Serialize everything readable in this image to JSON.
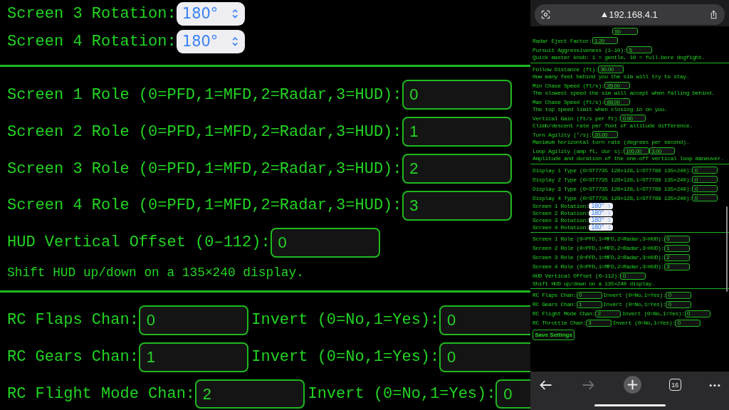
{
  "zoomed_view": {
    "rows": [
      {
        "kind": "select",
        "label": "Screen 3 Rotation:",
        "value": "180°"
      },
      {
        "kind": "select",
        "label": "Screen 4 Rotation:",
        "value": "180°"
      },
      {
        "kind": "rule"
      },
      {
        "kind": "field",
        "parts": [
          {
            "label": "Screen 1 Role (0=PFD,1=MFD,2=Radar,3=HUD):",
            "value": "0"
          }
        ]
      },
      {
        "kind": "field",
        "parts": [
          {
            "label": "Screen 2 Role (0=PFD,1=MFD,2=Radar,3=HUD):",
            "value": "1"
          }
        ]
      },
      {
        "kind": "field",
        "parts": [
          {
            "label": "Screen 3 Role (0=PFD,1=MFD,2=Radar,3=HUD):",
            "value": "2"
          }
        ]
      },
      {
        "kind": "field",
        "parts": [
          {
            "label": "Screen 4 Role (0=PFD,1=MFD,2=Radar,3=HUD):",
            "value": "3"
          }
        ]
      },
      {
        "kind": "field",
        "parts": [
          {
            "label": "HUD Vertical Offset (0–112):",
            "value": "0"
          }
        ]
      },
      {
        "kind": "note",
        "text": "Shift HUD up/down on a 135×240 display."
      },
      {
        "kind": "rule"
      },
      {
        "kind": "field",
        "parts": [
          {
            "label": "RC Flaps Chan:",
            "value": "0"
          },
          {
            "label": "Invert (0=No,1=Yes):",
            "value": "0"
          }
        ]
      },
      {
        "kind": "field",
        "parts": [
          {
            "label": "RC Gears Chan:",
            "value": "1"
          },
          {
            "label": "Invert (0=No,1=Yes):",
            "value": "0"
          }
        ]
      },
      {
        "kind": "field",
        "parts": [
          {
            "label": "RC Flight Mode Chan:",
            "value": "2"
          },
          {
            "label": "Invert (0=No,1=Yes):",
            "value": "0"
          }
        ]
      }
    ]
  },
  "browser": {
    "address": "192.168.4.1",
    "rows": [
      {
        "kind": "field",
        "parts": [
          {
            "value": "50"
          }
        ]
      },
      {
        "kind": "field",
        "parts": [
          {
            "label": "Radar Eject Factor:",
            "value": "1.20"
          }
        ]
      },
      {
        "kind": "field",
        "parts": [
          {
            "label": "Pursuit Aggressiveness (1–10):",
            "value": "5"
          }
        ]
      },
      {
        "kind": "note",
        "text": "Quick master knob: 1 = gentle, 10 = full-bore dogfight."
      },
      {
        "kind": "rule"
      },
      {
        "kind": "field",
        "parts": [
          {
            "label": "Follow Distance (ft):",
            "value": "30.00"
          }
        ]
      },
      {
        "kind": "note",
        "text": "How many feet behind you the sim will try to stay."
      },
      {
        "kind": "field",
        "parts": [
          {
            "label": "Min Chase Speed (ft/s):",
            "value": "35.00"
          }
        ]
      },
      {
        "kind": "note",
        "text": "The slowest speed the sim will accept when falling behind."
      },
      {
        "kind": "field",
        "parts": [
          {
            "label": "Max Chase Speed (ft/s):",
            "value": "88.00"
          }
        ]
      },
      {
        "kind": "note",
        "text": "The top speed limit when closing in on you."
      },
      {
        "kind": "field",
        "parts": [
          {
            "label": "Vertical Gain (ft/s per ft):",
            "value": "0.90"
          }
        ]
      },
      {
        "kind": "note",
        "text": "Climb/descent rate per foot of altitude difference."
      },
      {
        "kind": "field",
        "parts": [
          {
            "label": "Turn Agility (°/s):",
            "value": "20.00"
          }
        ]
      },
      {
        "kind": "note",
        "text": "Maximum horizontal turn rate (degrees per second)."
      },
      {
        "kind": "field",
        "parts": [
          {
            "label": "Loop Agility (amp ft, dur s):",
            "value": "100.00"
          },
          {
            "value": "3.00"
          }
        ]
      },
      {
        "kind": "note",
        "text": "Amplitude and duration of the one-off vertical loop maneuver."
      },
      {
        "kind": "rule"
      },
      {
        "kind": "field",
        "parts": [
          {
            "label": "Display 1 Type (0=ST7735 128×128,1=ST7789 135×240):",
            "value": "0"
          }
        ]
      },
      {
        "kind": "field",
        "parts": [
          {
            "label": "Display 2 Type (0=ST7735 128×128,1=ST7789 135×240):",
            "value": "0"
          }
        ]
      },
      {
        "kind": "field",
        "parts": [
          {
            "label": "Display 3 Type (0=ST7735 128×128,1=ST7789 135×240):",
            "value": "0"
          }
        ]
      },
      {
        "kind": "field",
        "parts": [
          {
            "label": "Display 4 Type (0=ST7735 128×128,1=ST7789 135×240):",
            "value": "0"
          }
        ]
      },
      {
        "kind": "select",
        "label": "Screen 1 Rotation:",
        "value": "180°"
      },
      {
        "kind": "select",
        "label": "Screen 2 Rotation:",
        "value": "180°"
      },
      {
        "kind": "select",
        "label": "Screen 3 Rotation:",
        "value": "180°"
      },
      {
        "kind": "select",
        "label": "Screen 4 Rotation:",
        "value": "180°"
      },
      {
        "kind": "rule"
      },
      {
        "kind": "field",
        "parts": [
          {
            "label": "Screen 1 Role (0=PFD,1=MFD,2=Radar,3=HUD):",
            "value": "0"
          }
        ]
      },
      {
        "kind": "field",
        "parts": [
          {
            "label": "Screen 2 Role (0=PFD,1=MFD,2=Radar,3=HUD):",
            "value": "1"
          }
        ]
      },
      {
        "kind": "field",
        "parts": [
          {
            "label": "Screen 3 Role (0=PFD,1=MFD,2=Radar,3=HUD):",
            "value": "2"
          }
        ]
      },
      {
        "kind": "field",
        "parts": [
          {
            "label": "Screen 4 Role (0=PFD,1=MFD,2=Radar,3=HUD):",
            "value": "3"
          }
        ]
      },
      {
        "kind": "field",
        "parts": [
          {
            "label": "HUD Vertical Offset (0–112):",
            "value": "0"
          }
        ]
      },
      {
        "kind": "note",
        "text": "Shift HUD up/down on a 135×240 display."
      },
      {
        "kind": "rule"
      },
      {
        "kind": "field",
        "parts": [
          {
            "label": "RC Flaps Chan:",
            "value": "0"
          },
          {
            "label": "Invert (0=No,1=Yes):",
            "value": "0"
          }
        ]
      },
      {
        "kind": "field",
        "parts": [
          {
            "label": "RC Gears Chan:",
            "value": "1"
          },
          {
            "label": "Invert (0=No,1=Yes):",
            "value": "0"
          }
        ]
      },
      {
        "kind": "field",
        "parts": [
          {
            "label": "RC Flight Mode Chan:",
            "value": "2"
          },
          {
            "label": "Invert (0=No,1=Yes):",
            "value": "0"
          }
        ]
      },
      {
        "kind": "field",
        "parts": [
          {
            "label": "RC Throttle Chan:",
            "value": "3"
          },
          {
            "label": "Invert (0=No,1=Yes):",
            "value": "0"
          }
        ]
      },
      {
        "kind": "button",
        "label": "Save Settings"
      }
    ],
    "toolbar": [
      {
        "kind": "back",
        "disabled": false
      },
      {
        "kind": "forward",
        "disabled": true
      },
      {
        "kind": "new-tab",
        "disabled": false
      },
      {
        "kind": "tabs",
        "label": "16",
        "disabled": false
      },
      {
        "kind": "more",
        "disabled": false
      }
    ]
  }
}
